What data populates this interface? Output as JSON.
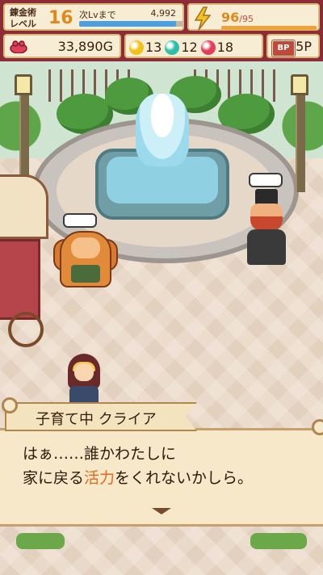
{
  "hud": {
    "level_label_1": "錬金術",
    "level_label_2": "レベル",
    "level": "16",
    "next_label": "次Lvまで",
    "next_value": "4,992",
    "exp_progress": 0.92,
    "stamina_value": "96",
    "stamina_max": "/95",
    "stamina_progress": 1.0,
    "money": "33,890G",
    "gems": [
      {
        "name": "yellow-orb",
        "color": "#f2c21a",
        "count": "13"
      },
      {
        "name": "teal-orb",
        "color": "#2fbfa8",
        "count": "12"
      },
      {
        "name": "red-orb",
        "color": "#e2405a",
        "count": "18"
      }
    ],
    "bp_icon": "BP",
    "bp_value": "5P"
  },
  "scene": {
    "characters": [
      "fox-merchant",
      "gentleman-npc",
      "girl-npc"
    ]
  },
  "dialog": {
    "speaker": "子育て中 クライア",
    "line1": "はぁ……誰かわたしに",
    "line2_pre": "家に戻る",
    "line2_highlight": "活力",
    "line2_post": "をくれないかしら。"
  },
  "colors": {
    "hud_bg": "#8b2c36",
    "highlight": "#e06a1a"
  }
}
